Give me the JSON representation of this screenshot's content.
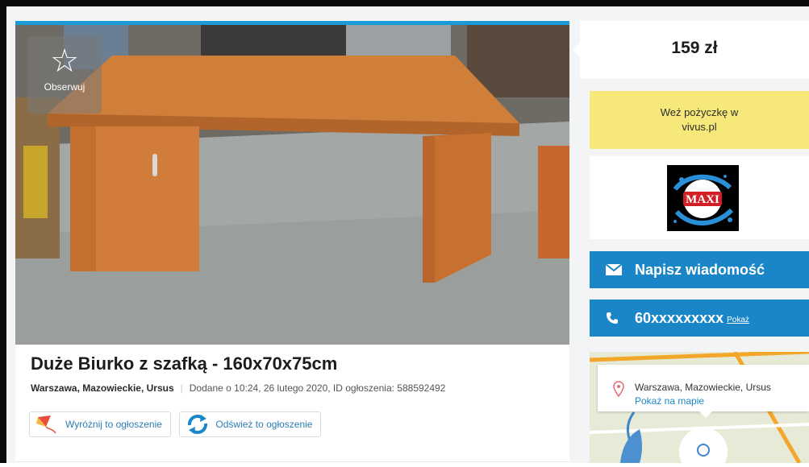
{
  "listing": {
    "observe_label": "Obserwuj",
    "title": "Duże Biurko z szafką - 160x70x75cm",
    "location": "Warszawa, Mazowieckie, Ursus",
    "added": "Dodane o 10:24, 26 lutego 2020, ID ogłoszenia: 588592492",
    "promote_label": "Wyróżnij to ogłoszenie",
    "refresh_label": "Odśwież to ogłoszenie"
  },
  "sidebar": {
    "price": "159 zł",
    "loan_line1": "Weź pożyczkę w",
    "loan_line2": "vivus.pl",
    "ad_logo_text": "MAXI",
    "message_label": "Napisz wiadomość",
    "phone_number": "60xxxxxxxxx",
    "phone_show": "Pokaż",
    "map_address": "Warszawa, Mazowieckie, Ursus",
    "map_link": "Pokaż na mapie"
  },
  "colors": {
    "accent": "#1a86c8",
    "loan_bg": "#f7e87a",
    "top_bar": "#1a9bd7"
  }
}
